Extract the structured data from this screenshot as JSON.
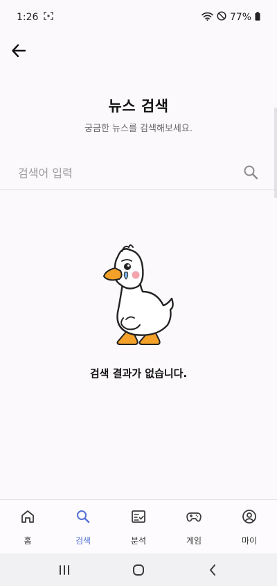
{
  "status_bar": {
    "time": "1:26",
    "battery": "77%"
  },
  "header": {
    "title": "뉴스 검색",
    "subtitle": "궁금한 뉴스를 검색해보세요."
  },
  "search": {
    "placeholder": "검색어 입력",
    "value": ""
  },
  "empty_state": {
    "message": "검색 결과가 없습니다."
  },
  "bottom_nav": {
    "items": [
      {
        "label": "홈",
        "icon": "home-icon"
      },
      {
        "label": "검색",
        "icon": "search-icon"
      },
      {
        "label": "분석",
        "icon": "analysis-icon"
      },
      {
        "label": "게임",
        "icon": "gamepad-icon"
      },
      {
        "label": "마이",
        "icon": "profile-icon"
      }
    ],
    "active_index": 1
  },
  "colors": {
    "accent": "#5471d6",
    "background": "#fcf9fc",
    "nav_background": "#fdfbfd"
  }
}
